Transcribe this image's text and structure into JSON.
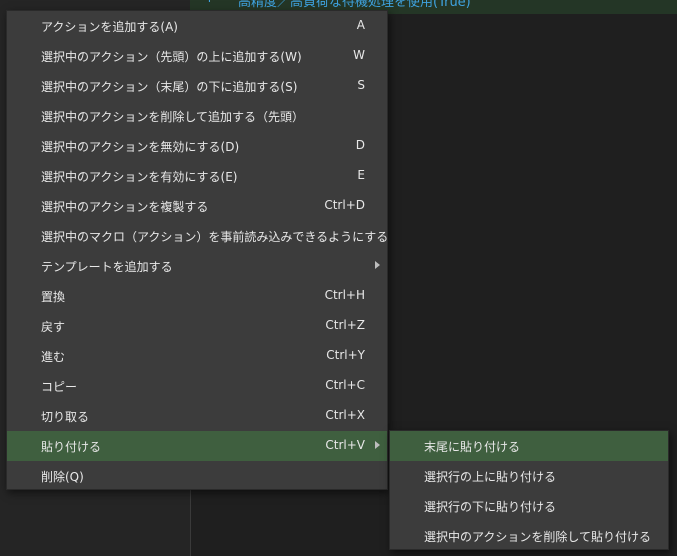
{
  "editor": {
    "line_marker": "↑",
    "line_text": "高精度／高負荷な待機処理を使用(True)"
  },
  "menu": {
    "items": [
      {
        "label": "アクションを追加する(A)",
        "shortcut": "A"
      },
      {
        "label": "選択中のアクション（先頭）の上に追加する(W)",
        "shortcut": "W"
      },
      {
        "label": "選択中のアクション（末尾）の下に追加する(S)",
        "shortcut": "S"
      },
      {
        "label": "選択中のアクションを削除して追加する（先頭）",
        "shortcut": ""
      },
      {
        "label": "選択中のアクションを無効にする(D)",
        "shortcut": "D"
      },
      {
        "label": "選択中のアクションを有効にする(E)",
        "shortcut": "E"
      },
      {
        "label": "選択中のアクションを複製する",
        "shortcut": "Ctrl+D"
      },
      {
        "label": "選択中のマクロ（アクション）を事前読み込みできるようにする",
        "shortcut": ""
      },
      {
        "label": "テンプレートを追加する",
        "shortcut": ""
      },
      {
        "label": "置換",
        "shortcut": "Ctrl+H"
      },
      {
        "label": "戻す",
        "shortcut": "Ctrl+Z"
      },
      {
        "label": "進む",
        "shortcut": "Ctrl+Y"
      },
      {
        "label": "コピー",
        "shortcut": "Ctrl+C"
      },
      {
        "label": "切り取る",
        "shortcut": "Ctrl+X"
      },
      {
        "label": "貼り付ける",
        "shortcut": "Ctrl+V"
      },
      {
        "label": "削除(Q)",
        "shortcut": ""
      }
    ]
  },
  "submenu": {
    "items": [
      {
        "label": "末尾に貼り付ける"
      },
      {
        "label": "選択行の上に貼り付ける"
      },
      {
        "label": "選択行の下に貼り付ける"
      },
      {
        "label": "選択中のアクションを削除して貼り付ける"
      }
    ]
  },
  "colors": {
    "menu_bg": "#3c3c3c",
    "highlight": "#3f5f3f",
    "text": "#e8e8e8"
  }
}
